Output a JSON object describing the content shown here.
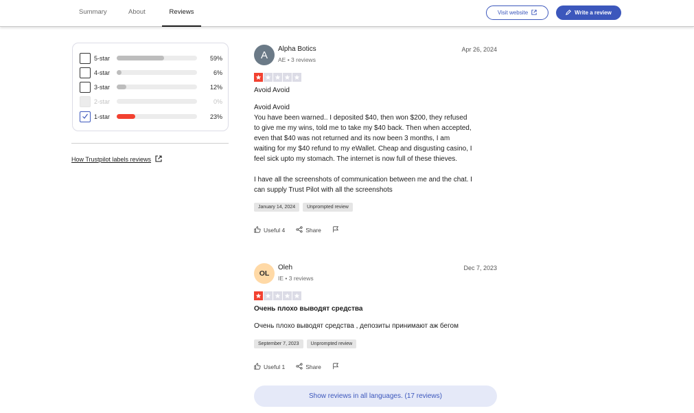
{
  "nav": {
    "tabs": [
      {
        "label": "Summary"
      },
      {
        "label": "About"
      },
      {
        "label": "Reviews"
      }
    ],
    "visit_website": "Visit website",
    "write_review": "Write a review"
  },
  "filter": {
    "rows": [
      {
        "label": "5-star",
        "percent": "59%",
        "fill": 0.59,
        "checked": false,
        "disabled": false
      },
      {
        "label": "4-star",
        "percent": "6%",
        "fill": 0.06,
        "checked": false,
        "disabled": false
      },
      {
        "label": "3-star",
        "percent": "12%",
        "fill": 0.12,
        "checked": false,
        "disabled": false
      },
      {
        "label": "2-star",
        "percent": "0%",
        "fill": 0.0,
        "checked": false,
        "disabled": true
      },
      {
        "label": "1-star",
        "percent": "23%",
        "fill": 0.23,
        "checked": true,
        "disabled": false
      }
    ],
    "labels_link": "How Trustpilot labels reviews"
  },
  "reviews": [
    {
      "avatar": "A",
      "name": "Alpha Botics",
      "meta": "AE • 3 reviews",
      "date": "Apr 26, 2024",
      "rating": 1,
      "title": "Avoid Avoid",
      "body_lines": [
        "Avoid Avoid",
        "You have been warned.. I deposited $40, then won $200, they refused",
        "to give me my wins, told me to take my $40 back. Then when accepted,",
        "even that $40 was not returned and its now been 3 months, I am",
        "waiting for my $40 refund to my eWallet. Cheap and disgusting casino, I",
        "feel sick upto my stomach. The internet is now full of these thieves.",
        "",
        "I have all the screenshots of communication between me and the chat. I",
        "can supply Trust Pilot with all the screenshots"
      ],
      "experience_date": "January 14, 2024",
      "tag": "Unprompted review",
      "useful": "Useful 4",
      "share": "Share"
    },
    {
      "avatar": "OL",
      "name": "Oleh",
      "meta": "IE • 3 reviews",
      "date": "Dec 7, 2023",
      "rating": 1,
      "title": "Очень плохо выводят средства",
      "body_lines": [
        "Очень плохо выводят средства , депозиты принимают аж бегом"
      ],
      "experience_date": "September 7, 2023",
      "tag": "Unprompted review",
      "useful": "Useful 1",
      "share": "Share"
    }
  ],
  "show_all": "Show reviews in all languages. (17 reviews)",
  "colors": {
    "accent": "#3c57bc",
    "star_red": "#f24130",
    "star_empty": "#dcdce6"
  }
}
